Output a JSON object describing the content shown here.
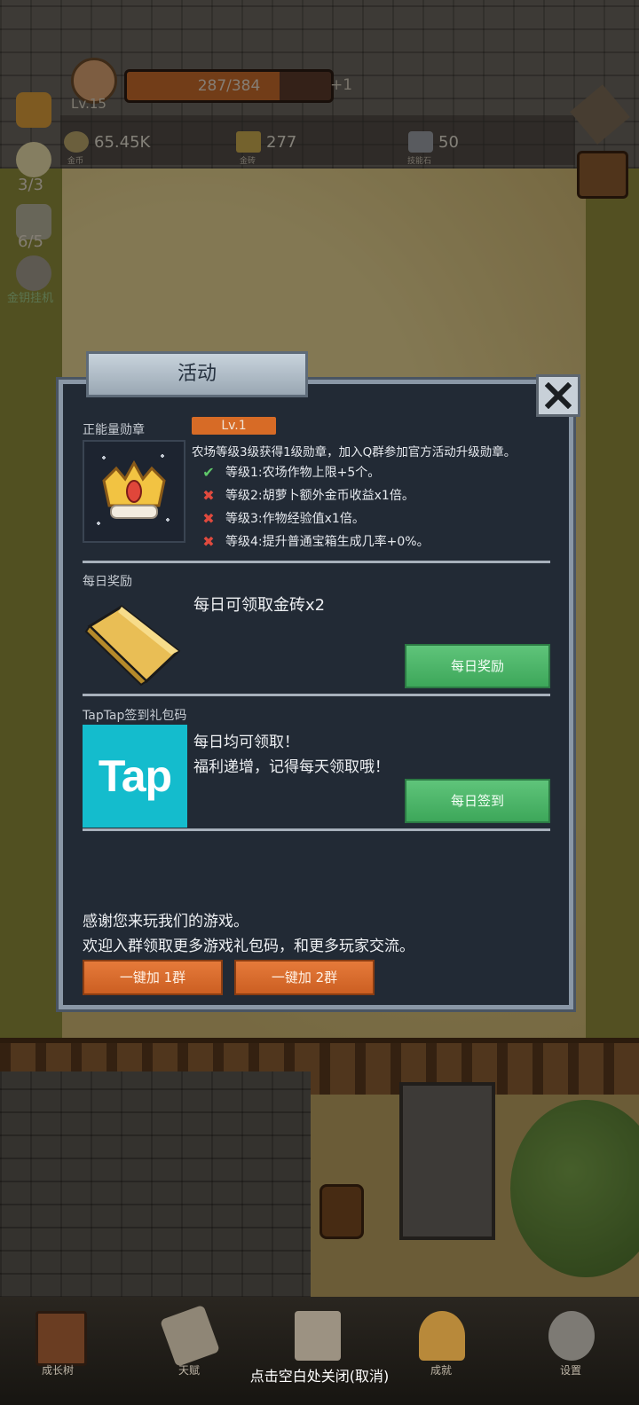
{
  "hud": {
    "level": "Lv.15",
    "xp_text": "287/384",
    "xp_fraction": 0.747,
    "xp_plus": "+1",
    "coins": "65.45K",
    "coins_caption": "金币",
    "gold_bricks": "277",
    "gold_bricks_caption": "金砖",
    "skill_stones": "50",
    "skill_stones_caption": "技能石",
    "side_counter_1": "3/3",
    "side_counter_2": "6/5",
    "side_label_3": "金钥挂机"
  },
  "modal": {
    "title": "活动",
    "badge": {
      "section_label": "正能量勋章",
      "level": "Lv.1",
      "description": "农场等级3级获得1级勋章，加入Q群参加官方活动升级勋章。",
      "perks": [
        {
          "text": "等级1:农场作物上限+5个。",
          "unlocked": true
        },
        {
          "text": "等级2:胡萝卜额外金币收益x1倍。",
          "unlocked": false
        },
        {
          "text": "等级3:作物经验值x1倍。",
          "unlocked": false
        },
        {
          "text": "等级4:提升普通宝箱生成几率+0%。",
          "unlocked": false
        }
      ]
    },
    "daily": {
      "section_label": "每日奖励",
      "reward_text": "每日可领取金砖x2",
      "button": "每日奖励"
    },
    "taptap": {
      "section_label": "TapTap签到礼包码",
      "logo_text": "Tap",
      "line1": "每日均可领取！",
      "line2": "福利递增，记得每天领取哦！",
      "button": "每日签到"
    },
    "footer": {
      "line1": "感谢您来玩我们的游戏。",
      "line2": "欢迎入群领取更多游戏礼包码，和更多玩家交流。",
      "group1_button": "一键加 1群",
      "group2_button": "一键加 2群"
    }
  },
  "bottom_nav": {
    "items": [
      "成长树",
      "天赋",
      "",
      "成就",
      "设置"
    ],
    "close_hint": "点击空白处关闭(取消)"
  },
  "colors": {
    "modal_bg": "#222a35",
    "accent_orange": "#d76b26",
    "accent_green": "#3da75a",
    "tap_cyan": "#14bccd"
  }
}
